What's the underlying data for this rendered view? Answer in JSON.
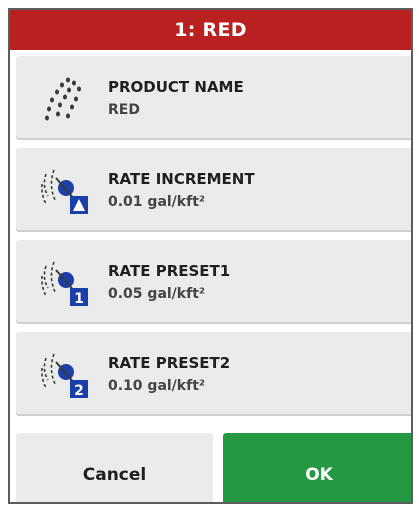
{
  "dialog": {
    "title": "1: RED",
    "rows": [
      {
        "label": "PRODUCT NAME",
        "value": "RED",
        "icon": "spray-droplets-icon"
      },
      {
        "label": "RATE INCREMENT",
        "value": "0.01 gal/kft²",
        "icon": "rate-increment-icon"
      },
      {
        "label": "RATE PRESET1",
        "value": "0.05 gal/kft²",
        "icon": "rate-preset-1-icon",
        "badge": "1"
      },
      {
        "label": "RATE PRESET2",
        "value": "0.10 gal/kft²",
        "icon": "rate-preset-2-icon",
        "badge": "2"
      }
    ],
    "cancel_label": "Cancel",
    "ok_label": "OK"
  },
  "colors": {
    "titlebar": "#b8211f",
    "ok_button": "#259942",
    "row_background": "#ebebeb",
    "icon_blue": "#1b3fa8"
  }
}
